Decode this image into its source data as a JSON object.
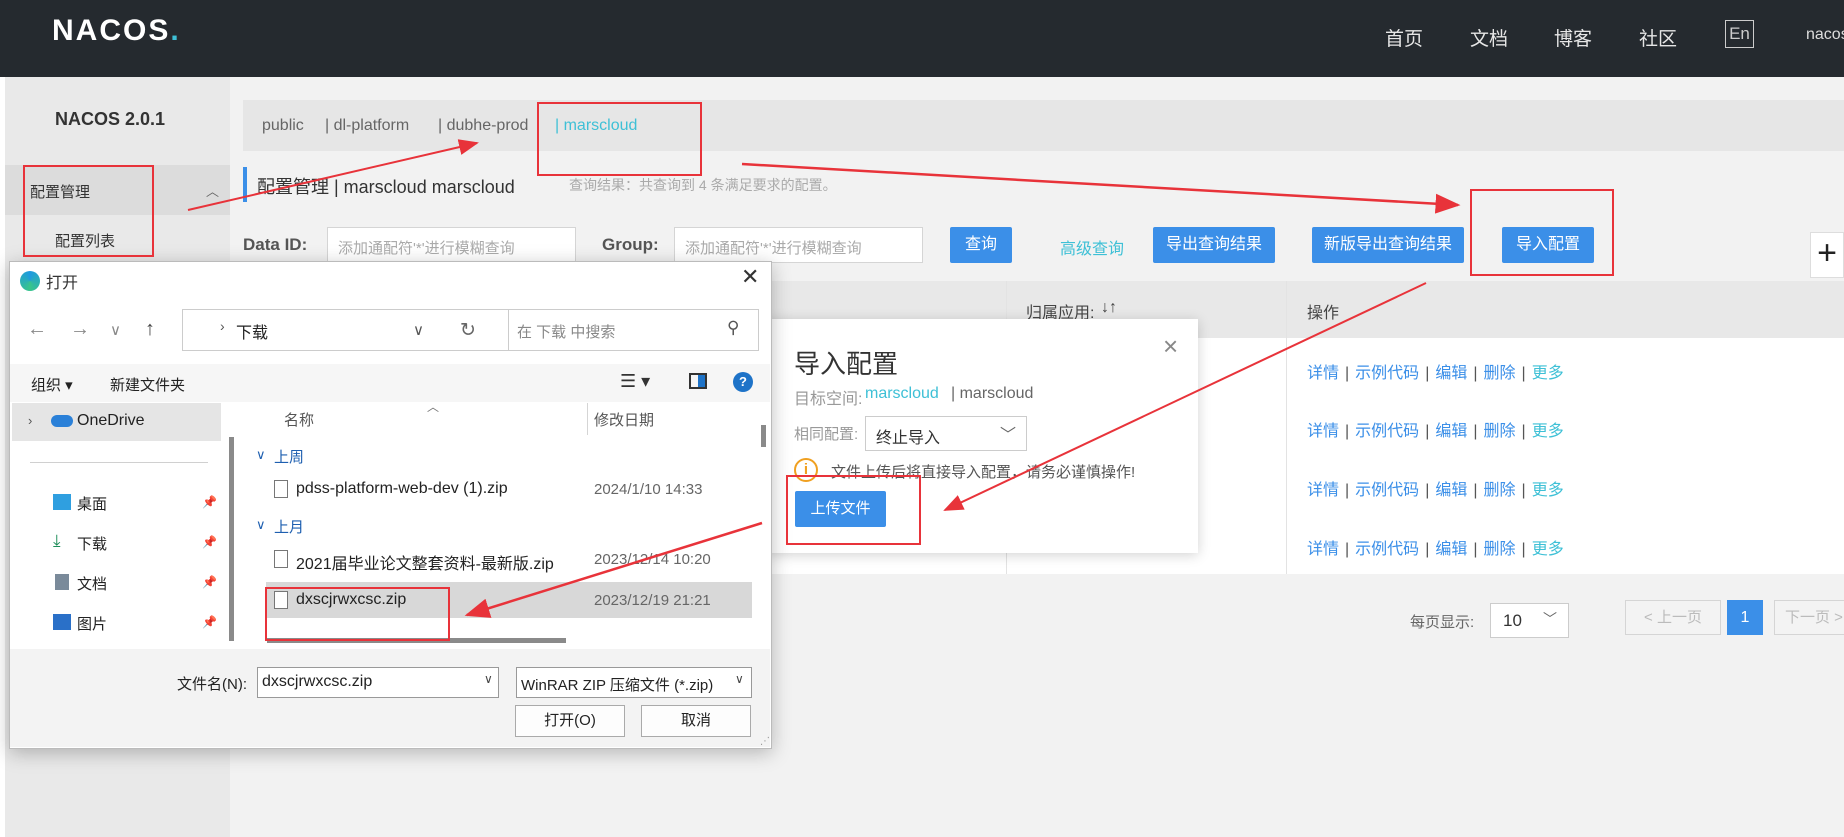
{
  "topbar": {
    "logo_text": "NACOS",
    "nav": [
      "首页",
      "文档",
      "博客",
      "社区"
    ],
    "lang": "En",
    "user": "nacos"
  },
  "sidebar": {
    "title": "NACOS 2.0.1",
    "menu_label": "配置管理",
    "submenu_label": "配置列表"
  },
  "namespaces": [
    "public",
    "| dl-platform",
    "| dubhe-prod",
    "| marscloud"
  ],
  "header": {
    "title": "配置管理 | marscloud marscloud",
    "result": "查询结果：共查询到 4 条满足要求的配置。"
  },
  "filters": {
    "data_id_label": "Data ID:",
    "data_id_placeholder": "添加通配符'*'进行模糊查询",
    "group_label": "Group:",
    "group_placeholder": "添加通配符'*'进行模糊查询",
    "query_btn": "查询",
    "advanced_btn": "高级查询",
    "export_btn": "导出查询结果",
    "new_export_btn": "新版导出查询结果",
    "import_btn": "导入配置",
    "plus": "+"
  },
  "table": {
    "col_app": "归属应用:",
    "col_app_sort": "↓↑",
    "col_ops": "操作",
    "actions": [
      "详情",
      "示例代码",
      "编辑",
      "删除",
      "更多"
    ],
    "separator": "|"
  },
  "pagination": {
    "label": "每页显示:",
    "size": "10",
    "prev": "< 上一页",
    "current": "1",
    "next": "下一页 >"
  },
  "import_dialog": {
    "title": "导入配置",
    "close": "×",
    "ns_label": "目标空间:",
    "ns_value1": "marscloud",
    "ns_value2": "| marscloud",
    "same_label": "相同配置:",
    "same_value": "终止导入",
    "warning_icon": "i",
    "warning": "文件上传后将直接导入配置，请务必谨慎操作!",
    "upload_btn": "上传文件"
  },
  "file_dialog": {
    "title": "打开",
    "close": "✕",
    "path": "下载",
    "search_placeholder": "在 下载 中搜索",
    "organize": "组织 ▾",
    "new_folder": "新建文件夹",
    "help_icon": "?",
    "onedrive": "OneDrive",
    "quick_access": [
      {
        "label": "桌面",
        "icon": "desktop-icon",
        "color": "#2f9fe0"
      },
      {
        "label": "下载",
        "icon": "download-icon",
        "color": "#1e8e5a"
      },
      {
        "label": "文档",
        "icon": "documents-icon",
        "color": "#7a8a9a"
      },
      {
        "label": "图片",
        "icon": "pictures-icon",
        "color": "#2a70c8"
      }
    ],
    "col_name": "名称",
    "col_date": "修改日期",
    "groups": [
      "上周",
      "上月"
    ],
    "files": [
      {
        "name": "pdss-platform-web-dev (1).zip",
        "date": "2024/1/10 14:33"
      },
      {
        "name": "2021届毕业论文整套资料-最新版.zip",
        "date": "2023/12/14 10:20"
      },
      {
        "name": "dxscjrwxcsc.zip",
        "date": "2023/12/19 21:21"
      }
    ],
    "filename_label": "文件名(N):",
    "filename_value": "dxscjrwxcsc.zip",
    "filetype": "WinRAR ZIP 压缩文件 (*.zip)",
    "open_btn": "打开(O)",
    "cancel_btn": "取消"
  },
  "colors": {
    "primary": "#3b8fe8",
    "accent": "#3ec0d6",
    "annotation": "#e8333a",
    "topbar": "#252a2f"
  }
}
